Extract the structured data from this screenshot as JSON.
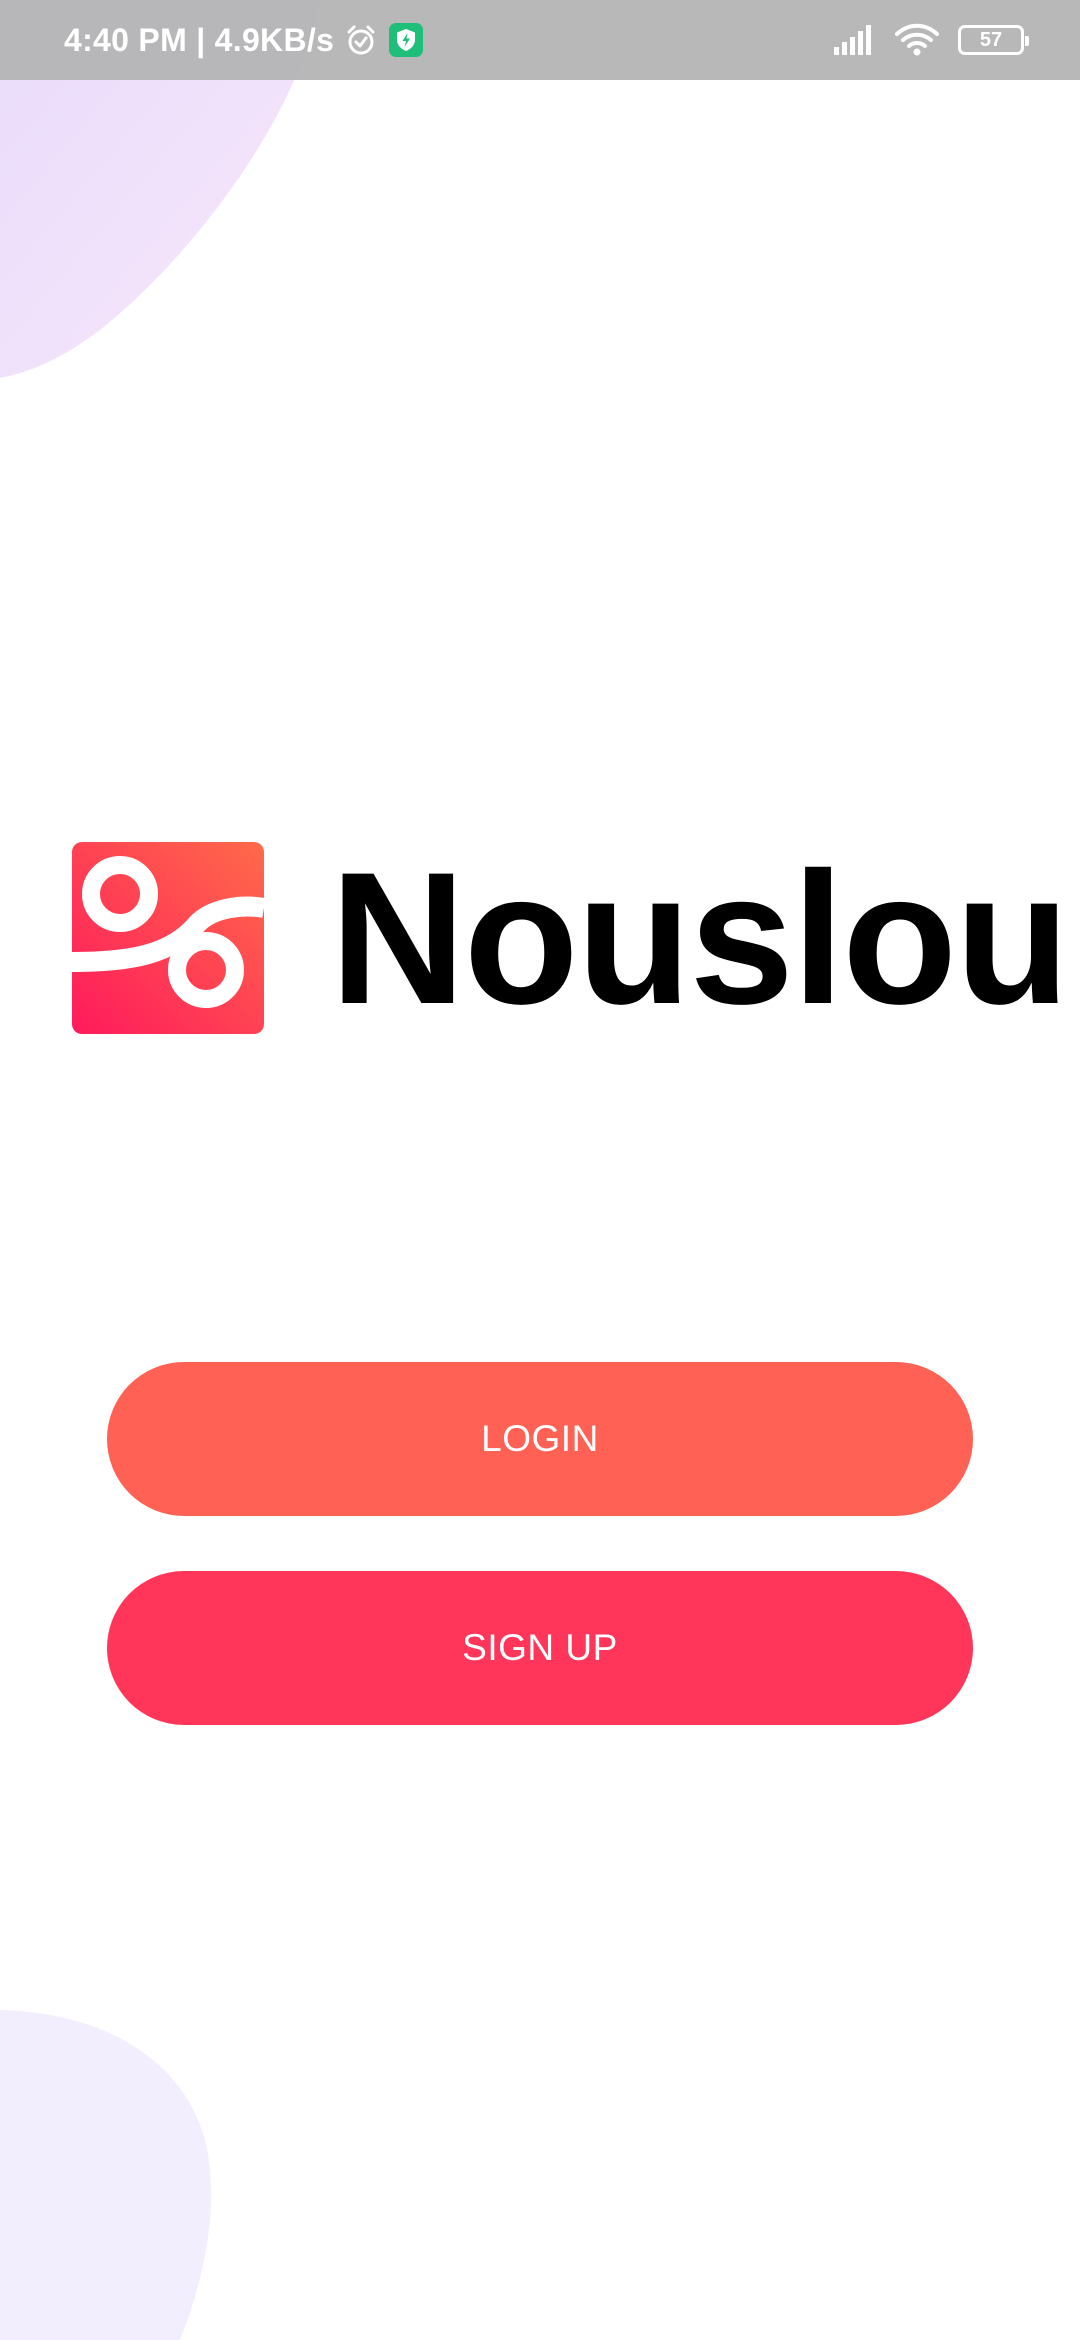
{
  "status_bar": {
    "time_speed": "4:40 PM | 4.9KB/s",
    "battery_level": "57",
    "icons": [
      "alarm-icon",
      "shield-icon",
      "signal-icon",
      "wifi-icon",
      "battery-icon"
    ],
    "shield_color": "#1fbf7a"
  },
  "logo": {
    "name": "Nouslou",
    "gradient_from": "#ff1a5c",
    "gradient_to": "#ff6a4a"
  },
  "buttons": {
    "login_label": "LOGIN",
    "login_color": "#ff6154",
    "signup_label": "SIGN UP",
    "signup_color": "#ff3659"
  },
  "background": {
    "blob_top_color": "#ead9fb",
    "blob_bottom_color": "#f3eefd"
  }
}
